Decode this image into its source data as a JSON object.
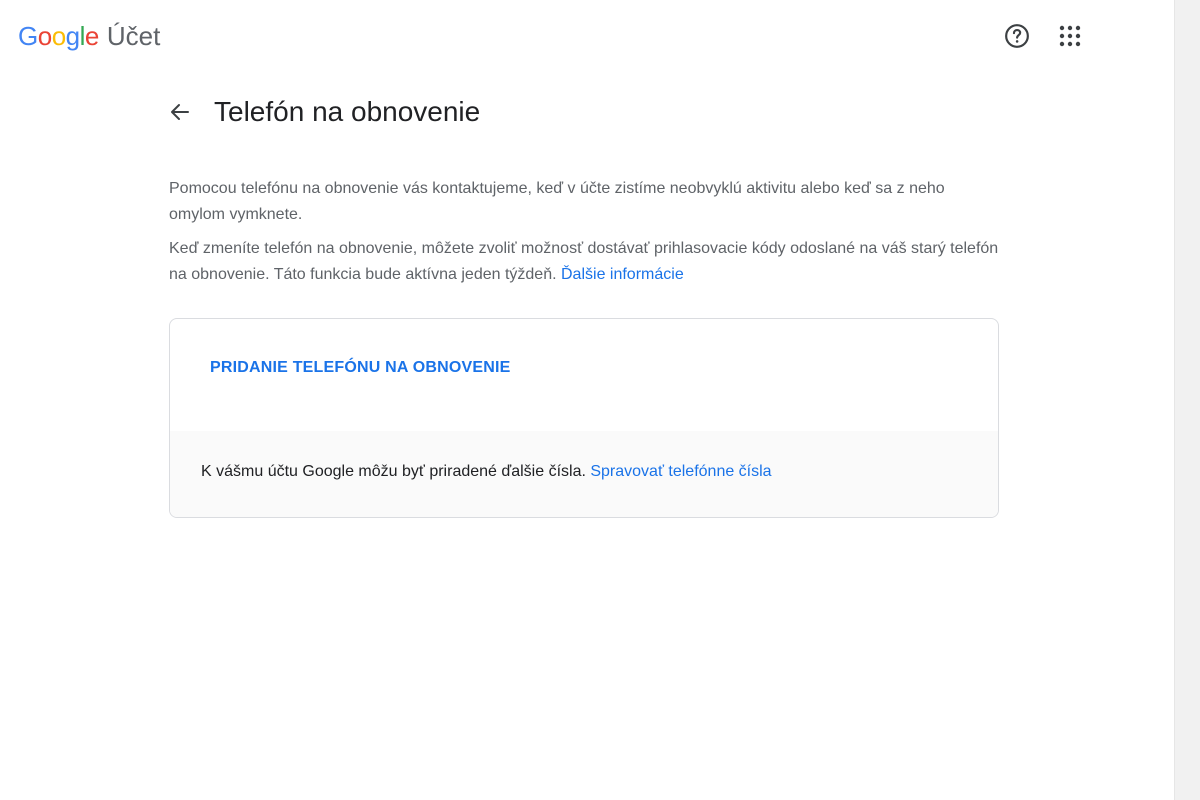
{
  "header": {
    "logo_letters": [
      "G",
      "o",
      "o",
      "g",
      "l",
      "e"
    ],
    "product_name": "Účet",
    "help_icon": "help-circle-icon",
    "apps_icon": "apps-grid-icon"
  },
  "page": {
    "back_icon": "arrow-back-icon",
    "title": "Telefón na obnovenie"
  },
  "description": {
    "paragraph1": "Pomocou telefónu na obnovenie vás kontaktujeme, keď v účte zistíme neobvyklú aktivitu alebo keď sa z neho omylom vymknete.",
    "paragraph2": "Keď zmeníte telefón na obnovenie, môžete zvoliť možnosť dostávať prihlasovacie kódy odoslané na váš starý telefón na obnovenie. Táto funkcia bude aktívna jeden týždeň.",
    "learn_more_link": "Ďalšie informácie"
  },
  "card": {
    "add_phone_label": "PRIDANIE TELEFÓNU NA OBNOVENIE",
    "note_text": "K vášmu účtu Google môžu byť priradené ďalšie čísla.",
    "manage_link": "Spravovať telefónne čísla"
  },
  "colors": {
    "google_blue": "#4285f4",
    "google_red": "#ea4335",
    "google_yellow": "#fbbc05",
    "google_green": "#34a853",
    "link": "#1a73e8",
    "secondary_text": "#5f6368"
  }
}
